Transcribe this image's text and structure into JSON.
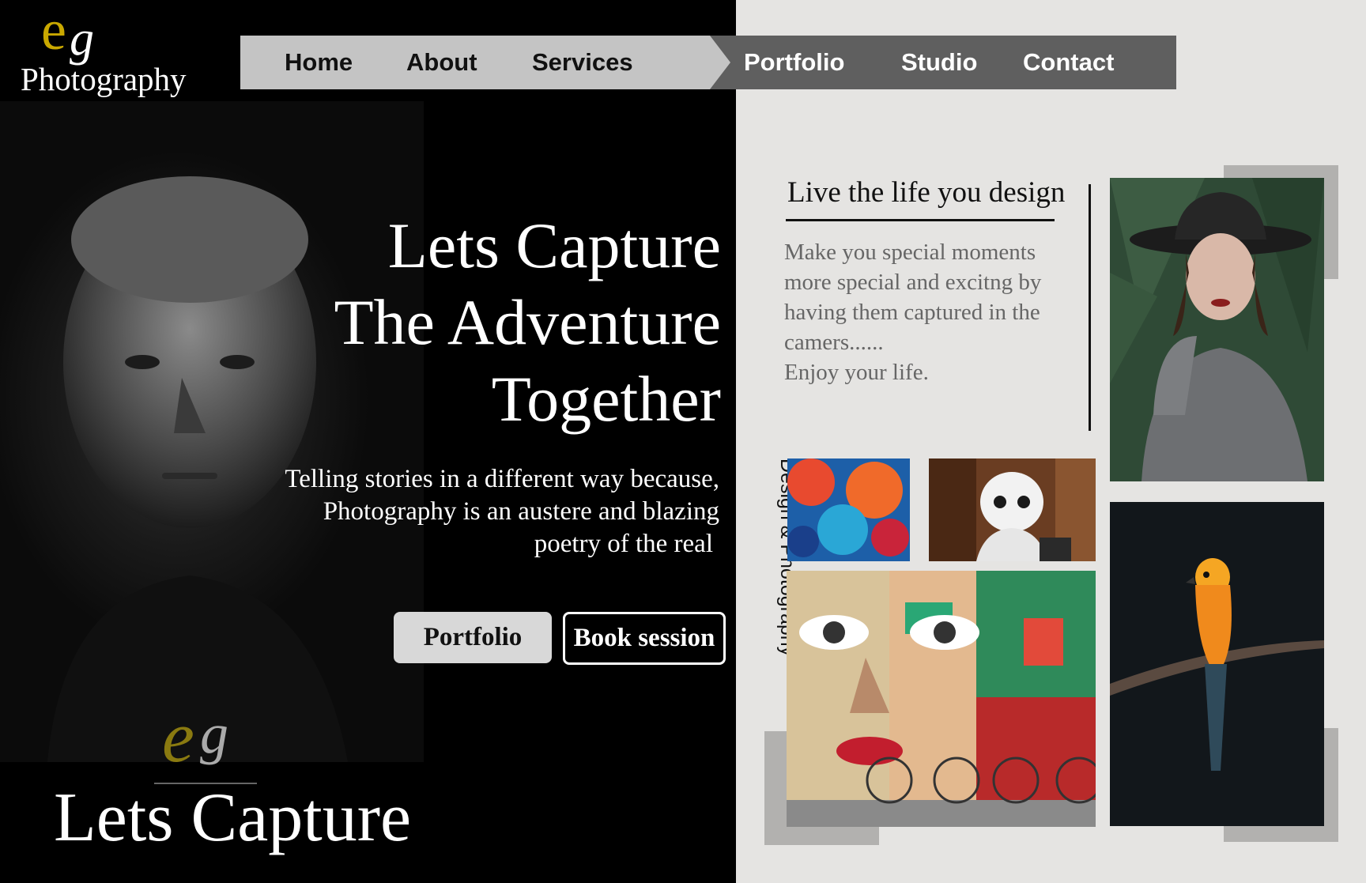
{
  "brand": {
    "mark_e": "e",
    "mark_g": "g",
    "name": "Photography"
  },
  "nav": {
    "items": [
      "Home",
      "About",
      "Services",
      "Portfolio",
      "Studio",
      "Contact"
    ]
  },
  "hero": {
    "headline_lines": [
      "Lets Capture",
      "The Adventure",
      "Together"
    ],
    "subtext_lines": [
      "Telling stories in a different way because,",
      "Photography is an austere and blazing",
      "poetry of the real"
    ],
    "primary_button": "Portfolio",
    "secondary_button": "Book session"
  },
  "footer": {
    "mark_e": "e",
    "mark_g": "g",
    "title": "Lets Capture"
  },
  "aside": {
    "tagline": "Live the life you design",
    "body_lines": [
      "Make you special moments",
      "more special and excitng by",
      "having them captured in the",
      "camers......",
      "Enjoy your life."
    ],
    "vertical_label": "Design & Photography"
  },
  "gallery": [
    "Portrait of man",
    "Woman in hat",
    "Colored ink smoke",
    "Robot",
    "Graffiti mural with bicycles",
    "Parrot on branch"
  ],
  "colors": {
    "accent_gold": "#c9a800",
    "nav_light": "#c4c4c4",
    "nav_dark": "#5f5f5f",
    "right_bg": "#e5e4e2"
  }
}
